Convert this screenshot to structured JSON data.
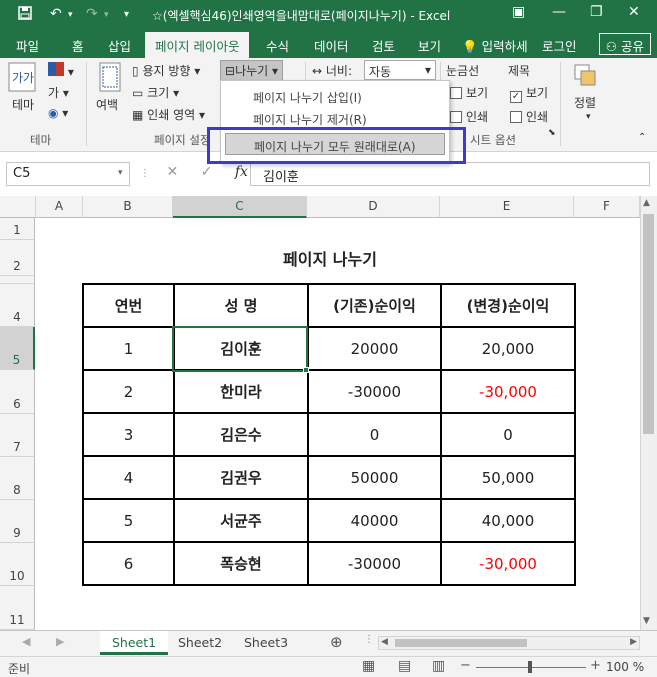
{
  "window": {
    "title": "☆(엑셀핵심46)인쇄영역을내맘대로(페이지나누기) - Excel",
    "minimize": "—",
    "restore": "❐",
    "close": "✕"
  },
  "ribbon_tabs": [
    "파일",
    "홈",
    "삽입",
    "페이지 레이아웃",
    "수식",
    "데이터",
    "검토",
    "보기"
  ],
  "tell_me": "입력하세",
  "signin": "로그인",
  "share": "공유",
  "ribbon": {
    "theme_label": "테마",
    "margins_label": "여백",
    "orientation": "용지 방향",
    "size": "크기",
    "print_area": "인쇄 영역",
    "breaks": "나누기",
    "width_label": "너비:",
    "width_value": "자동",
    "gridlines": "눈금선",
    "headings": "제목",
    "view": "보기",
    "print": "인쇄",
    "arrange": "정렬",
    "group_theme": "테마",
    "group_page_setup": "페이지 설정",
    "group_sheet_options": "시트 옵션"
  },
  "dropdown": {
    "items": [
      "페이지 나누기 삽입(I)",
      "페이지 나누기 제거(R)",
      "페이지 나누기 모두 원래대로(A)"
    ]
  },
  "formula_bar": {
    "name_box": "C5",
    "fx": "fx",
    "content": "김이훈"
  },
  "columns": [
    "A",
    "B",
    "C",
    "D",
    "E",
    "F"
  ],
  "rows": [
    "1",
    "2",
    "3",
    "4",
    "5",
    "6",
    "7",
    "8",
    "9",
    "10",
    "11"
  ],
  "sheet": {
    "title": "페이지  나누기",
    "headers": [
      "연번",
      "성    명",
      "(기존)순이익",
      "(변경)순이익"
    ],
    "data": [
      [
        "1",
        "김이훈",
        "20000",
        "20,000"
      ],
      [
        "2",
        "한미라",
        "-30000",
        "-30,000"
      ],
      [
        "3",
        "김은수",
        "0",
        "0"
      ],
      [
        "4",
        "김권우",
        "50000",
        "50,000"
      ],
      [
        "5",
        "서균주",
        "40000",
        "40,000"
      ],
      [
        "6",
        "폭승현",
        "-30000",
        "-30,000"
      ]
    ],
    "negative_color": "#ff0000"
  },
  "sheet_tabs": [
    "Sheet1",
    "Sheet2",
    "Sheet3"
  ],
  "status": {
    "ready": "준비",
    "zoom": "100 %"
  },
  "colors": {
    "accent": "#217346",
    "highlight_box": "#3c3ccc"
  }
}
